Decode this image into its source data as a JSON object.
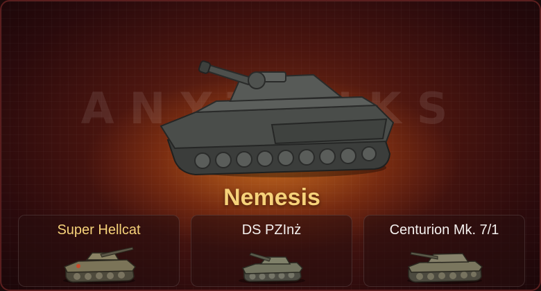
{
  "watermark": "ANYTANKS",
  "selected_tank": {
    "name": "Nemesis",
    "image_icon": "tank-icon"
  },
  "variants": [
    {
      "label": "Super Hellcat",
      "selected": true,
      "icon": "tank-icon"
    },
    {
      "label": "DS PZInż",
      "selected": false,
      "icon": "tank-icon"
    },
    {
      "label": "Centurion Mk. 7/1",
      "selected": false,
      "icon": "tank-icon"
    }
  ],
  "colors": {
    "accent_gold": "#f6d27a",
    "background_dark": "#2a0a0c",
    "glow_orange": "#ff9628",
    "card_border": "#5a1e1e"
  }
}
